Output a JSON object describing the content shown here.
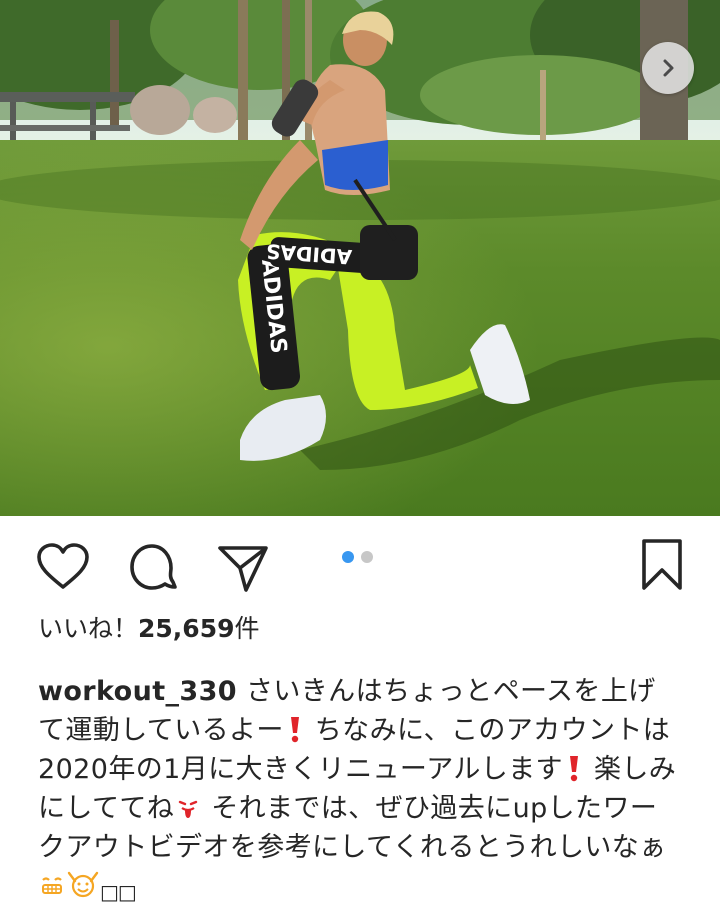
{
  "post": {
    "image_alt": "Woman kneeling on park grass wearing neon leggings",
    "carousel": {
      "current": 1,
      "total": 2
    }
  },
  "actions": {
    "like_icon": "heart-icon",
    "comment_icon": "comment-icon",
    "share_icon": "send-icon",
    "save_icon": "bookmark-icon",
    "next_icon": "chevron-right-icon"
  },
  "likes": {
    "label": "いいね！",
    "count": "25,659",
    "suffix": "件"
  },
  "caption": {
    "username": "workout_330",
    "part1": "さいきんはちょっとペースを上げて運動しているよー",
    "part2": "ちなみに、このアカウントは2020年の1月に大きくリニューアルします",
    "part3": "楽しみにしててね",
    "part4": "それまでは、ぜひ過去にupしたワークアウトビデオを参考にしてくれるとうれしいなぁ",
    "emojis": [
      "exclamation-mark-icon",
      "exclamation-mark-icon",
      "tongue-out-face-icon",
      "grinning-face-icon",
      "raising-hands-face-icon"
    ]
  },
  "colors": {
    "accent": "#3897f0",
    "text": "#262626",
    "exclamation": "#e0242a",
    "emoji_orange": "#f5a623"
  }
}
